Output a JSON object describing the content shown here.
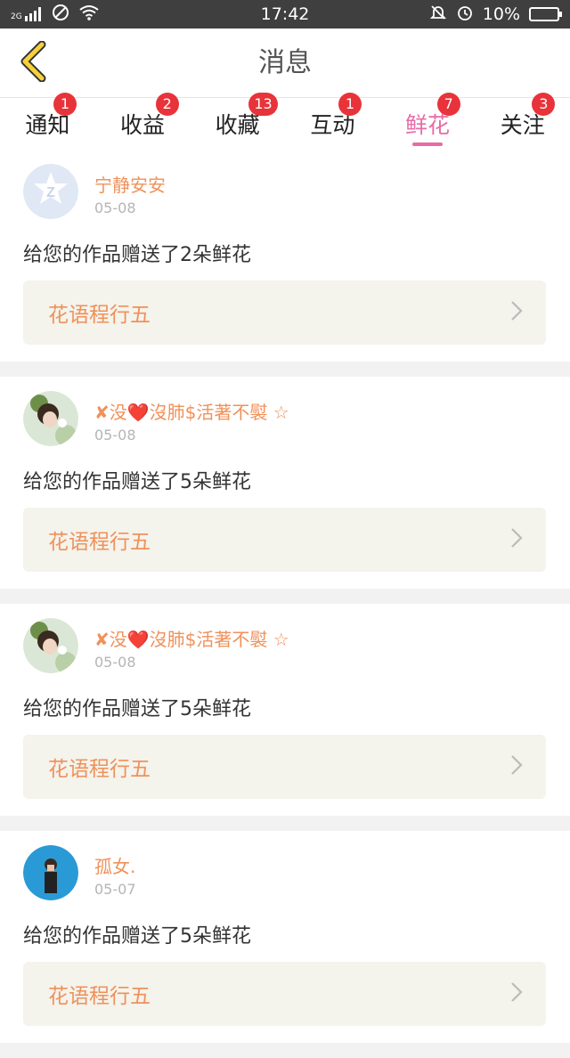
{
  "status_bar": {
    "network": "2G",
    "time": "17:42",
    "battery": "10%",
    "battery_level": 0.1
  },
  "header": {
    "title": "消息"
  },
  "tabs": [
    {
      "label": "通知",
      "badge": "1",
      "active": false
    },
    {
      "label": "收益",
      "badge": "2",
      "active": false
    },
    {
      "label": "收藏",
      "badge": "13",
      "active": false
    },
    {
      "label": "互动",
      "badge": "1",
      "active": false
    },
    {
      "label": "鲜花",
      "badge": "7",
      "active": true
    },
    {
      "label": "关注",
      "badge": "3",
      "active": false
    }
  ],
  "messages": [
    {
      "username": "宁静安安",
      "date": "05-08",
      "text": "给您的作品赠送了2朵鲜花",
      "work_title": "花语程行五",
      "avatar": "default-avatar-icon"
    },
    {
      "username": "✘没❤️沒肺$活著不褽 ☆",
      "date": "05-08",
      "text": "给您的作品赠送了5朵鲜花",
      "work_title": "花语程行五",
      "avatar": "user-photo-avatar"
    },
    {
      "username": "✘没❤️沒肺$活著不褽 ☆",
      "date": "05-08",
      "text": "给您的作品赠送了5朵鲜花",
      "work_title": "花语程行五",
      "avatar": "user-photo-avatar"
    },
    {
      "username": "孤女.",
      "date": "05-07",
      "text": "给您的作品赠送了5朵鲜花",
      "work_title": "花语程行五",
      "avatar": "user-photo-avatar"
    }
  ],
  "colors": {
    "accent_pink": "#e86ba7",
    "username_orange": "#f0915a",
    "badge_red": "#e8333a",
    "back_arrow_yellow": "#f7d13a"
  }
}
